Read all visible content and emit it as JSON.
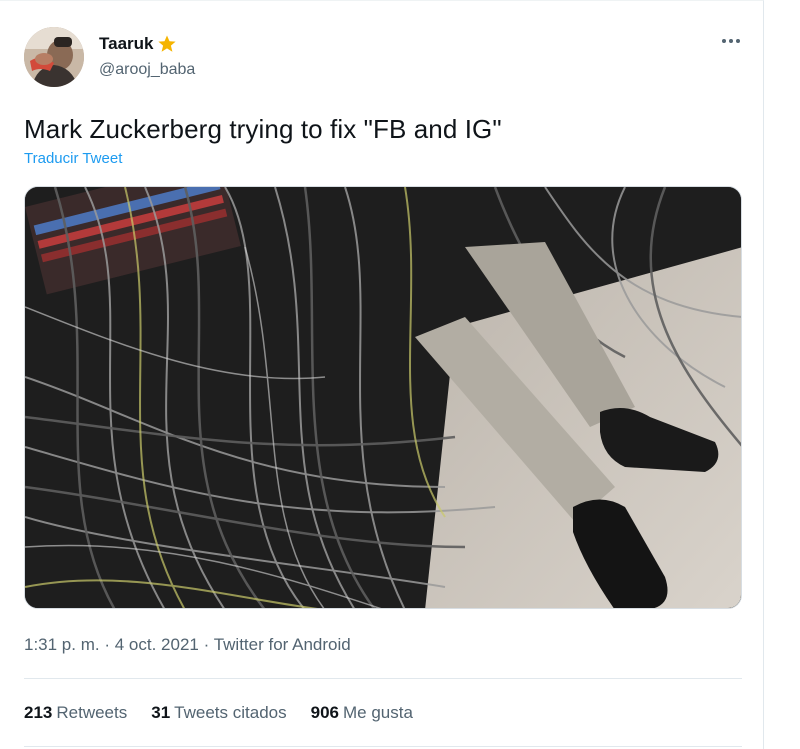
{
  "tweet": {
    "display_name": "Taaruk",
    "handle": "@arooj_baba",
    "text": "Mark Zuckerberg trying to fix \"FB and IG\"",
    "translate_label": "Traducir Tweet",
    "time": "1:31 p. m.",
    "date": "4 oct. 2021",
    "separator": "·",
    "source": "Twitter for Android",
    "stats": {
      "retweets_count": "213",
      "retweets_label": "Retweets",
      "quotes_count": "31",
      "quotes_label": "Tweets citados",
      "likes_count": "906",
      "likes_label": "Me gusta"
    }
  },
  "icons": {
    "verified_badge": "star-icon",
    "more": "more-options-icon"
  },
  "colors": {
    "link": "#1d9bf0",
    "secondary_text": "#536471",
    "primary_text": "#0f1419",
    "star": "#f5b400"
  }
}
